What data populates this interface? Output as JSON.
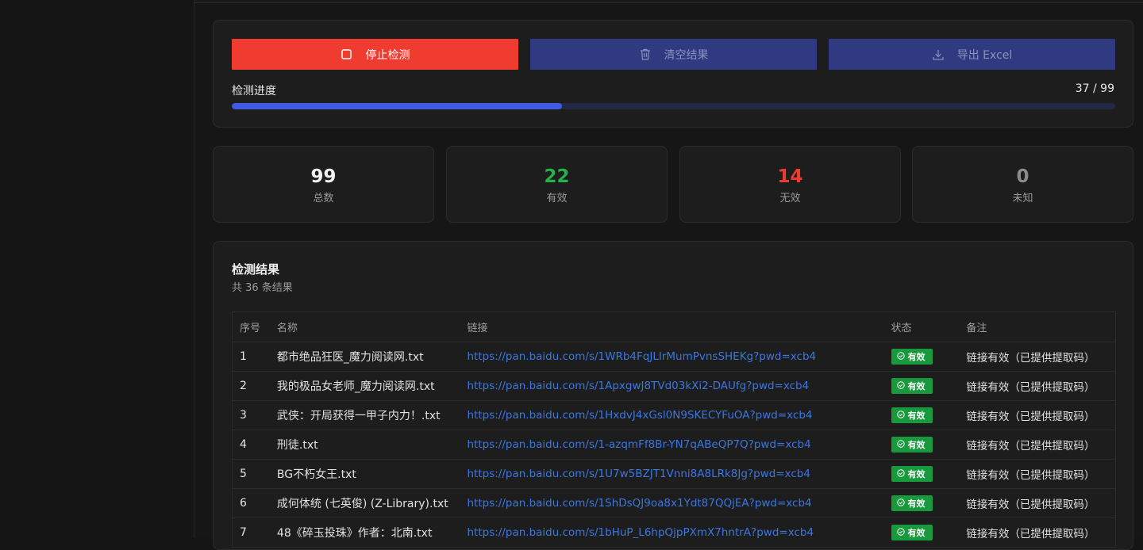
{
  "controls": {
    "stop_label": "停止检测",
    "clear_label": "清空结果",
    "export_label": "导出 Excel",
    "progress_label": "检测进度",
    "progress_count": "37 / 99",
    "progress_fraction": 0.3737,
    "colors": {
      "stop": "#f03c30",
      "secondary": "#2f3a80",
      "progress": "#3f5be0"
    }
  },
  "stats": [
    {
      "value": "99",
      "label": "总数",
      "color": "#f2f2f2"
    },
    {
      "value": "22",
      "label": "有效",
      "color": "#22b14c"
    },
    {
      "value": "14",
      "label": "无效",
      "color": "#f03c30"
    },
    {
      "value": "0",
      "label": "未知",
      "color": "#8c8c8c"
    }
  ],
  "results": {
    "title": "检测结果",
    "subtitle": "共 36 条结果",
    "columns": {
      "idx": "序号",
      "name": "名称",
      "link": "链接",
      "status": "状态",
      "note": "备注"
    },
    "rows": [
      {
        "idx": "1",
        "name": "都市绝品狂医_魔力阅读网.txt",
        "link": "https://pan.baidu.com/s/1WRb4FqJLIrMumPvnsSHEKg?pwd=xcb4",
        "status": "有效",
        "note": "链接有效（已提供提取码）"
      },
      {
        "idx": "2",
        "name": "我的极品女老师_魔力阅读网.txt",
        "link": "https://pan.baidu.com/s/1ApxgwJ8TVd03kXi2-DAUfg?pwd=xcb4",
        "status": "有效",
        "note": "链接有效（已提供提取码）"
      },
      {
        "idx": "3",
        "name": "武侠：开局获得一甲子内力！.txt",
        "link": "https://pan.baidu.com/s/1HxdvJ4xGsl0N9SKECYFuOA?pwd=xcb4",
        "status": "有效",
        "note": "链接有效（已提供提取码）"
      },
      {
        "idx": "4",
        "name": "刑徒.txt",
        "link": "https://pan.baidu.com/s/1-azqmFf8Br-YN7qABeQP7Q?pwd=xcb4",
        "status": "有效",
        "note": "链接有效（已提供提取码）"
      },
      {
        "idx": "5",
        "name": "BG不朽女王.txt",
        "link": "https://pan.baidu.com/s/1U7w5BZJT1Vnni8A8LRk8Jg?pwd=xcb4",
        "status": "有效",
        "note": "链接有效（已提供提取码）"
      },
      {
        "idx": "6",
        "name": "成何体统 (七英俊) (Z-Library).txt",
        "link": "https://pan.baidu.com/s/1ShDsQJ9oa8x1Ydt87QQjEA?pwd=xcb4",
        "status": "有效",
        "note": "链接有效（已提供提取码）"
      },
      {
        "idx": "7",
        "name": "48《碎玉投珠》作者：北南.txt",
        "link": "https://pan.baidu.com/s/1bHuP_L6hpQjpPXmX7hntrA?pwd=xcb4",
        "status": "有效",
        "note": "链接有效（已提供提取码）"
      }
    ]
  }
}
